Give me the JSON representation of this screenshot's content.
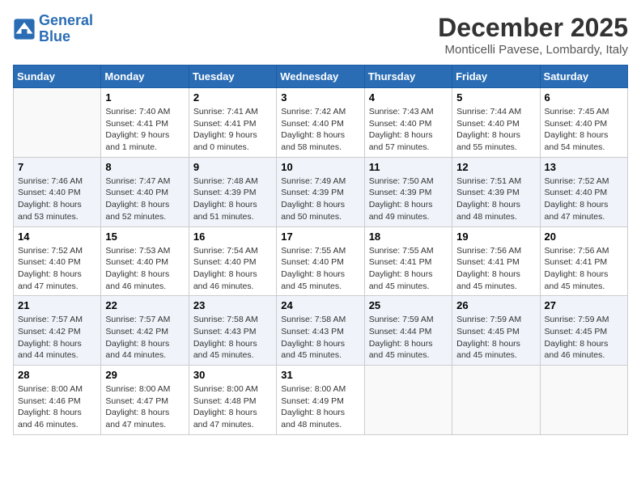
{
  "header": {
    "logo_line1": "General",
    "logo_line2": "Blue",
    "month_title": "December 2025",
    "location": "Monticelli Pavese, Lombardy, Italy"
  },
  "weekdays": [
    "Sunday",
    "Monday",
    "Tuesday",
    "Wednesday",
    "Thursday",
    "Friday",
    "Saturday"
  ],
  "weeks": [
    [
      {
        "day": null,
        "info": null
      },
      {
        "day": "1",
        "info": "Sunrise: 7:40 AM\nSunset: 4:41 PM\nDaylight: 9 hours\nand 1 minute."
      },
      {
        "day": "2",
        "info": "Sunrise: 7:41 AM\nSunset: 4:41 PM\nDaylight: 9 hours\nand 0 minutes."
      },
      {
        "day": "3",
        "info": "Sunrise: 7:42 AM\nSunset: 4:40 PM\nDaylight: 8 hours\nand 58 minutes."
      },
      {
        "day": "4",
        "info": "Sunrise: 7:43 AM\nSunset: 4:40 PM\nDaylight: 8 hours\nand 57 minutes."
      },
      {
        "day": "5",
        "info": "Sunrise: 7:44 AM\nSunset: 4:40 PM\nDaylight: 8 hours\nand 55 minutes."
      },
      {
        "day": "6",
        "info": "Sunrise: 7:45 AM\nSunset: 4:40 PM\nDaylight: 8 hours\nand 54 minutes."
      }
    ],
    [
      {
        "day": "7",
        "info": "Sunrise: 7:46 AM\nSunset: 4:40 PM\nDaylight: 8 hours\nand 53 minutes."
      },
      {
        "day": "8",
        "info": "Sunrise: 7:47 AM\nSunset: 4:40 PM\nDaylight: 8 hours\nand 52 minutes."
      },
      {
        "day": "9",
        "info": "Sunrise: 7:48 AM\nSunset: 4:39 PM\nDaylight: 8 hours\nand 51 minutes."
      },
      {
        "day": "10",
        "info": "Sunrise: 7:49 AM\nSunset: 4:39 PM\nDaylight: 8 hours\nand 50 minutes."
      },
      {
        "day": "11",
        "info": "Sunrise: 7:50 AM\nSunset: 4:39 PM\nDaylight: 8 hours\nand 49 minutes."
      },
      {
        "day": "12",
        "info": "Sunrise: 7:51 AM\nSunset: 4:39 PM\nDaylight: 8 hours\nand 48 minutes."
      },
      {
        "day": "13",
        "info": "Sunrise: 7:52 AM\nSunset: 4:40 PM\nDaylight: 8 hours\nand 47 minutes."
      }
    ],
    [
      {
        "day": "14",
        "info": "Sunrise: 7:52 AM\nSunset: 4:40 PM\nDaylight: 8 hours\nand 47 minutes."
      },
      {
        "day": "15",
        "info": "Sunrise: 7:53 AM\nSunset: 4:40 PM\nDaylight: 8 hours\nand 46 minutes."
      },
      {
        "day": "16",
        "info": "Sunrise: 7:54 AM\nSunset: 4:40 PM\nDaylight: 8 hours\nand 46 minutes."
      },
      {
        "day": "17",
        "info": "Sunrise: 7:55 AM\nSunset: 4:40 PM\nDaylight: 8 hours\nand 45 minutes."
      },
      {
        "day": "18",
        "info": "Sunrise: 7:55 AM\nSunset: 4:41 PM\nDaylight: 8 hours\nand 45 minutes."
      },
      {
        "day": "19",
        "info": "Sunrise: 7:56 AM\nSunset: 4:41 PM\nDaylight: 8 hours\nand 45 minutes."
      },
      {
        "day": "20",
        "info": "Sunrise: 7:56 AM\nSunset: 4:41 PM\nDaylight: 8 hours\nand 45 minutes."
      }
    ],
    [
      {
        "day": "21",
        "info": "Sunrise: 7:57 AM\nSunset: 4:42 PM\nDaylight: 8 hours\nand 44 minutes."
      },
      {
        "day": "22",
        "info": "Sunrise: 7:57 AM\nSunset: 4:42 PM\nDaylight: 8 hours\nand 44 minutes."
      },
      {
        "day": "23",
        "info": "Sunrise: 7:58 AM\nSunset: 4:43 PM\nDaylight: 8 hours\nand 45 minutes."
      },
      {
        "day": "24",
        "info": "Sunrise: 7:58 AM\nSunset: 4:43 PM\nDaylight: 8 hours\nand 45 minutes."
      },
      {
        "day": "25",
        "info": "Sunrise: 7:59 AM\nSunset: 4:44 PM\nDaylight: 8 hours\nand 45 minutes."
      },
      {
        "day": "26",
        "info": "Sunrise: 7:59 AM\nSunset: 4:45 PM\nDaylight: 8 hours\nand 45 minutes."
      },
      {
        "day": "27",
        "info": "Sunrise: 7:59 AM\nSunset: 4:45 PM\nDaylight: 8 hours\nand 46 minutes."
      }
    ],
    [
      {
        "day": "28",
        "info": "Sunrise: 8:00 AM\nSunset: 4:46 PM\nDaylight: 8 hours\nand 46 minutes."
      },
      {
        "day": "29",
        "info": "Sunrise: 8:00 AM\nSunset: 4:47 PM\nDaylight: 8 hours\nand 47 minutes."
      },
      {
        "day": "30",
        "info": "Sunrise: 8:00 AM\nSunset: 4:48 PM\nDaylight: 8 hours\nand 47 minutes."
      },
      {
        "day": "31",
        "info": "Sunrise: 8:00 AM\nSunset: 4:49 PM\nDaylight: 8 hours\nand 48 minutes."
      },
      {
        "day": null,
        "info": null
      },
      {
        "day": null,
        "info": null
      },
      {
        "day": null,
        "info": null
      }
    ]
  ]
}
